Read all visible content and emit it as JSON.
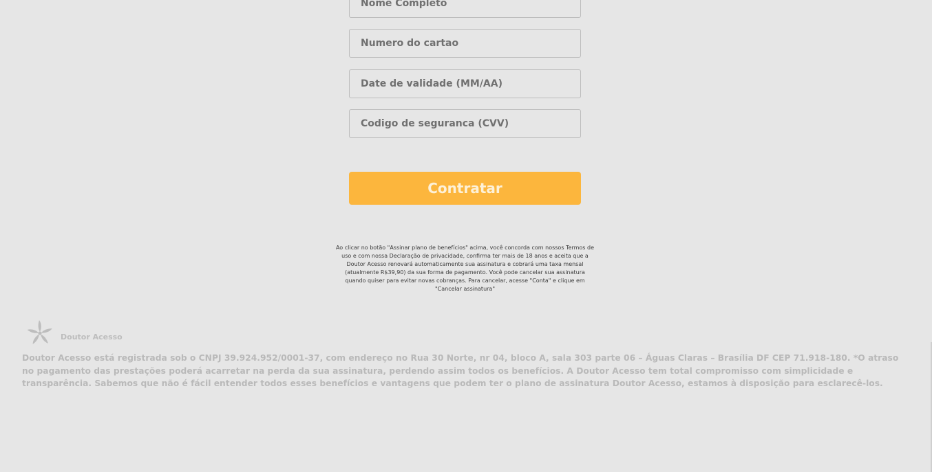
{
  "form": {
    "full_name_placeholder": "Nome Completo",
    "card_number_placeholder": "Numero do cartao",
    "expiry_placeholder": "Date de validade (MM/AA)",
    "cvv_placeholder": "Codigo de seguranca (CVV)",
    "submit_label": "Contratar"
  },
  "legal_notice": "Ao clicar no botão \"Assinar plano de benefícios\" acima, você concorda com nossos Termos de uso e com nossa Declaração de privacidade, confirma ter mais de 18 anos e aceita que a Doutor Acesso renovará automaticamente sua assinatura e cobrará uma taxa mensal (atualmente R$39,90) da sua forma de pagamento. Você pode cancelar sua assinatura quando quiser para evitar novas cobranças. Para cancelar, acesse \"Conta\" e clique em \"Cancelar assinatura\"",
  "footer": {
    "brand_name": "Doutor Acesso",
    "logo_icon": "star-flower-icon",
    "text": "Doutor Acesso está registrada sob o CNPJ 39.924.952/0001-37, com endereço no Rua 30 Norte, nr 04, bloco A, sala 303 parte 06 – Águas Claras – Brasília DF CEP 71.918-180. *O atraso no pagamento das prestações poderá acarretar na perda da sua assinatura, perdendo assim todos os benefícios. A Doutor Acesso tem total compromisso com simplicidade e transparência. Sabemos que não é fácil entender todos esses benefícios e vantagens que podem ter o plano de assinatura Doutor Acesso, estamos à disposição para esclarecê-los."
  },
  "colors": {
    "background": "#e6e6e6",
    "button": "#fcb63d",
    "button_text": "#fdf1d8",
    "field_border": "#bcbcbc",
    "muted_text": "#b9b9b9"
  }
}
